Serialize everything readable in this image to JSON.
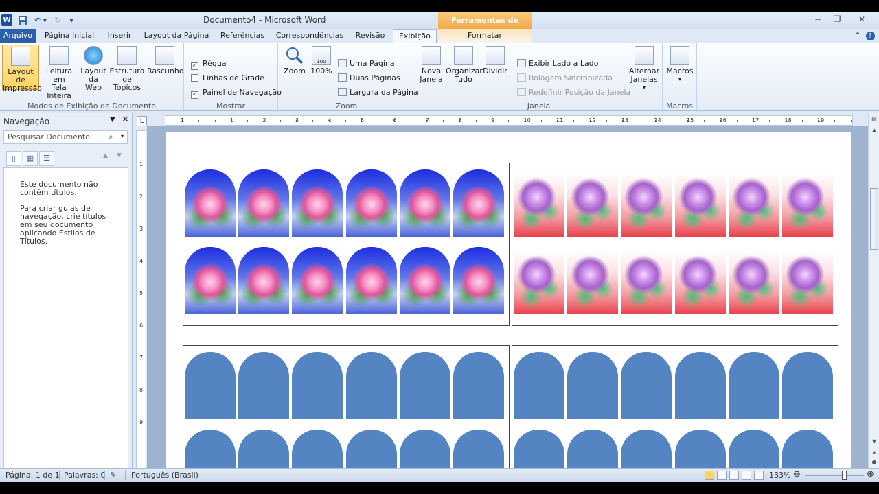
{
  "titlebar": {
    "document_title": "Documento4  -  Microsoft Word",
    "context_tools": "Ferramentas de Desenho",
    "window_buttons": [
      "−",
      "❐",
      "✕"
    ]
  },
  "tabs": {
    "arquivo": "Arquivo",
    "items": [
      "Página Inicial",
      "Inserir",
      "Layout da Página",
      "Referências",
      "Correspondências",
      "Revisão",
      "Exibição",
      "Formatar"
    ]
  },
  "ribbon": {
    "modos": {
      "label": "Modos de Exibição de Documento",
      "buttons": [
        "Layout de\nImpressão",
        "Leitura em\nTela Inteira",
        "Layout\nda Web",
        "Estrutura\nde Tópicos",
        "Rascunho"
      ]
    },
    "mostrar": {
      "label": "Mostrar",
      "regua": "Régua",
      "linhas": "Linhas de Grade",
      "painel": "Painel de Navegação"
    },
    "zoom": {
      "label": "Zoom",
      "zoom_btn": "Zoom",
      "cem_btn": "100%",
      "cem_icon_text": "100",
      "uma": "Uma Página",
      "duas": "Duas Páginas",
      "largura": "Largura da Página"
    },
    "janela": {
      "label": "Janela",
      "nova": "Nova\nJanela",
      "organizar": "Organizar\nTudo",
      "dividir": "Dividir",
      "lado": "Exibir Lado a Lado",
      "rolagem": "Rolagem Sincronizada",
      "redefinir": "Redefinir Posição da Janela",
      "alternar": "Alternar\nJanelas"
    },
    "macros": {
      "label": "Macros",
      "btn": "Macros"
    }
  },
  "nav": {
    "title": "Navegação",
    "search_placeholder": "Pesquisar Documento",
    "msg1": "Este documento não contém títulos.",
    "msg2": "Para criar guias de navegação, crie títulos em seu documento aplicando Estilos de Títulos."
  },
  "ruler": {
    "corner": "L",
    "h_numbers": [
      "1",
      "1",
      "2",
      "3",
      "4",
      "5",
      "6",
      "7",
      "8",
      "9",
      "10",
      "11",
      "12",
      "13",
      "14",
      "15",
      "16",
      "17",
      "18",
      "19"
    ],
    "v_numbers": [
      "1",
      "2",
      "3",
      "4",
      "5",
      "6",
      "7",
      "8",
      "9"
    ]
  },
  "status": {
    "pagina": "Página: 1 de 1",
    "palavras": "Palavras: 0",
    "idioma": "Português (Brasil)",
    "zoom": "133%",
    "zoom_level_fraction": 0.66
  }
}
